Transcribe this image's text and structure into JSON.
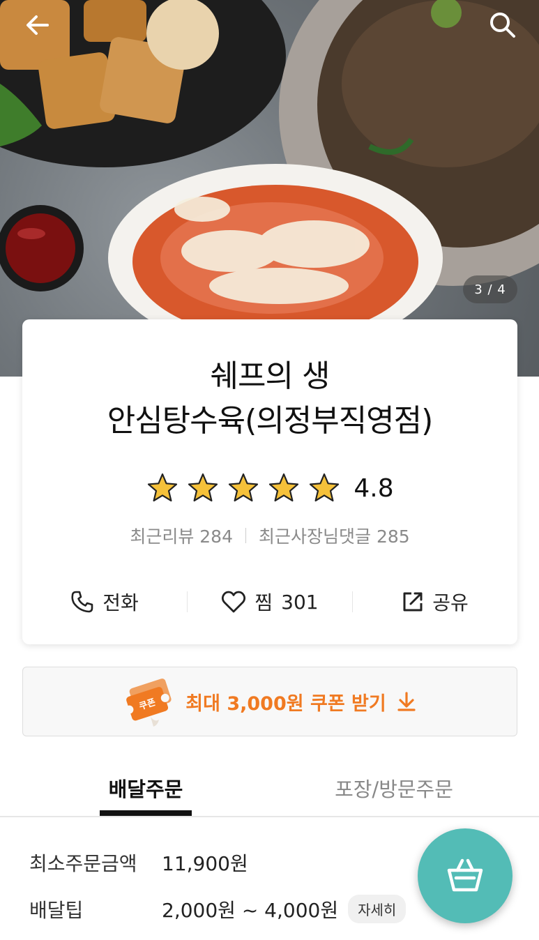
{
  "gallery": {
    "counter": "3 / 4"
  },
  "store": {
    "name_line1": "쉐프의 생",
    "name_line2": "안심탕수육(의정부직영점)",
    "rating": "4.8",
    "stars_filled": 5,
    "stars_total": 5,
    "recent_reviews_label": "최근리뷰",
    "recent_reviews_count": "284",
    "owner_replies_label": "최근사장님댓글",
    "owner_replies_count": "285"
  },
  "actions": {
    "call_label": "전화",
    "like_label": "찜",
    "like_count": "301",
    "share_label": "공유"
  },
  "coupon": {
    "badge_text": "쿠폰",
    "text": "최대 3,000원 쿠폰 받기"
  },
  "tabs": {
    "delivery": "배달주문",
    "pickup": "포장/방문주문",
    "active": "delivery"
  },
  "order_info": {
    "min_order_label": "최소주문금액",
    "min_order_value": "11,900원",
    "delivery_tip_label": "배달팁",
    "delivery_tip_value": "2,000원 ~ 4,000원",
    "detail_button": "자세히"
  },
  "colors": {
    "accent_orange": "#f07a22",
    "cart_teal": "#53bcb6",
    "star_gold": "#f5c13a"
  },
  "icons": [
    "back-arrow-icon",
    "search-icon",
    "star-icon",
    "phone-icon",
    "heart-icon",
    "share-icon",
    "coupon-icon",
    "download-arrow-icon",
    "basket-icon"
  ]
}
